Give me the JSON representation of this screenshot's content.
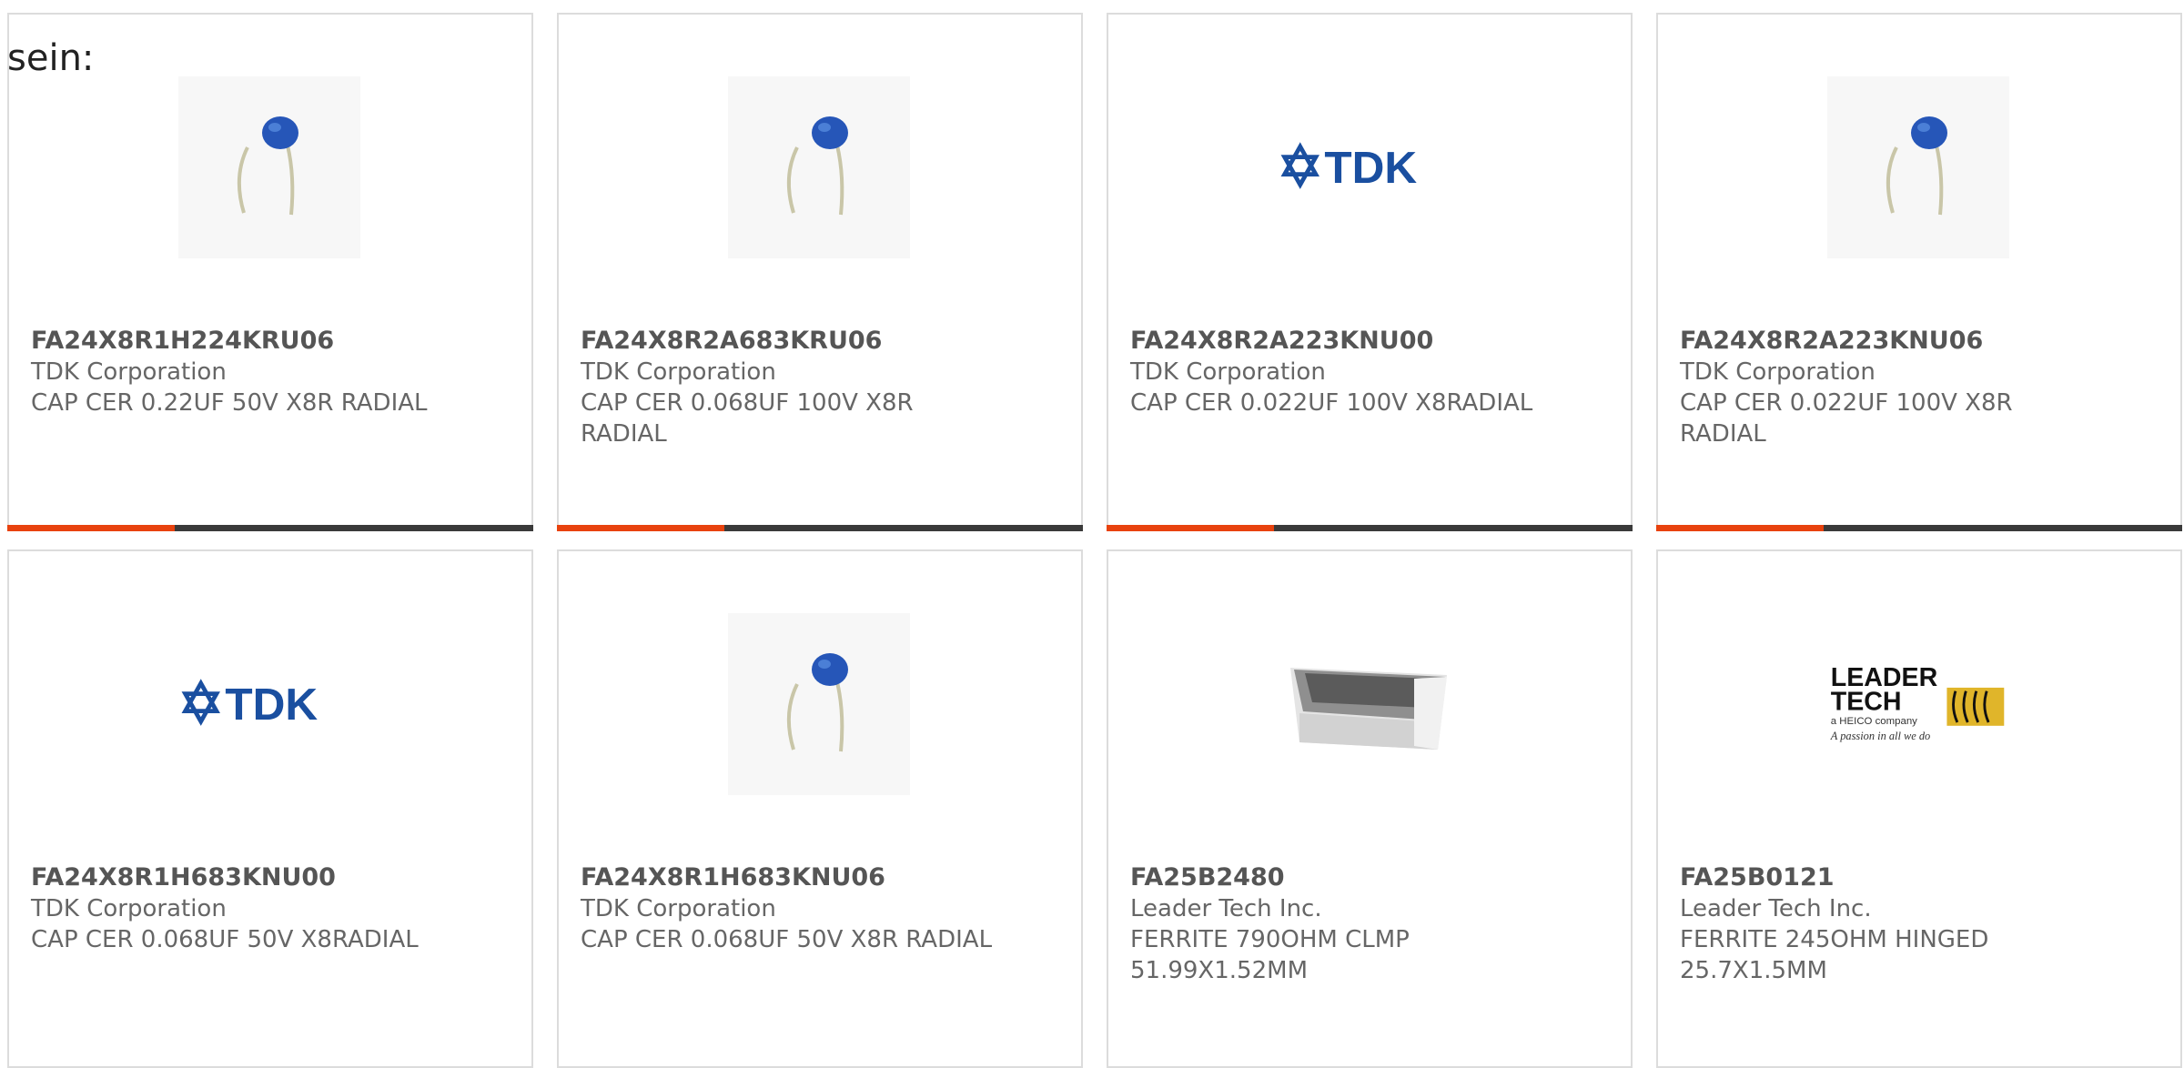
{
  "lead_text": "sein:",
  "colors": {
    "accent": "#e8420e",
    "bar": "#3a3a3a",
    "tdk_blue": "#1a4fa0"
  },
  "products": [
    {
      "part_number": "FA24X8R1H224KRU06",
      "manufacturer": "TDK Corporation",
      "description": "CAP CER 0.22UF 50V X8R RADIAL",
      "image": "capacitor-photo"
    },
    {
      "part_number": "FA24X8R2A683KRU06",
      "manufacturer": "TDK Corporation",
      "description": "CAP CER 0.068UF 100V X8R RADIAL",
      "image": "capacitor-photo"
    },
    {
      "part_number": "FA24X8R2A223KNU00",
      "manufacturer": "TDK Corporation",
      "description": "CAP CER 0.022UF 100V X8RADIAL",
      "image": "tdk-logo",
      "logo_text": "TDK"
    },
    {
      "part_number": "FA24X8R2A223KNU06",
      "manufacturer": "TDK Corporation",
      "description": "CAP CER 0.022UF 100V X8R RADIAL",
      "image": "capacitor-photo"
    },
    {
      "part_number": "FA24X8R1H683KNU00",
      "manufacturer": "TDK Corporation",
      "description": "CAP CER 0.068UF 50V X8RADIAL",
      "image": "tdk-logo",
      "logo_text": "TDK"
    },
    {
      "part_number": "FA24X8R1H683KNU06",
      "manufacturer": "TDK Corporation",
      "description": "CAP CER 0.068UF 50V X8R RADIAL",
      "image": "capacitor-photo"
    },
    {
      "part_number": "FA25B2480",
      "manufacturer": "Leader Tech Inc.",
      "description": "FERRITE 790OHM CLMP 51.99X1.52MM",
      "image": "ferrite-photo"
    },
    {
      "part_number": "FA25B0121",
      "manufacturer": "Leader Tech Inc.",
      "description": "FERRITE 245OHM HINGED 25.7X1.5MM",
      "image": "leader-tech-logo",
      "logo_lines": [
        "LEADER",
        "TECH",
        "a HEICO company",
        "A passion in all we do"
      ]
    }
  ]
}
